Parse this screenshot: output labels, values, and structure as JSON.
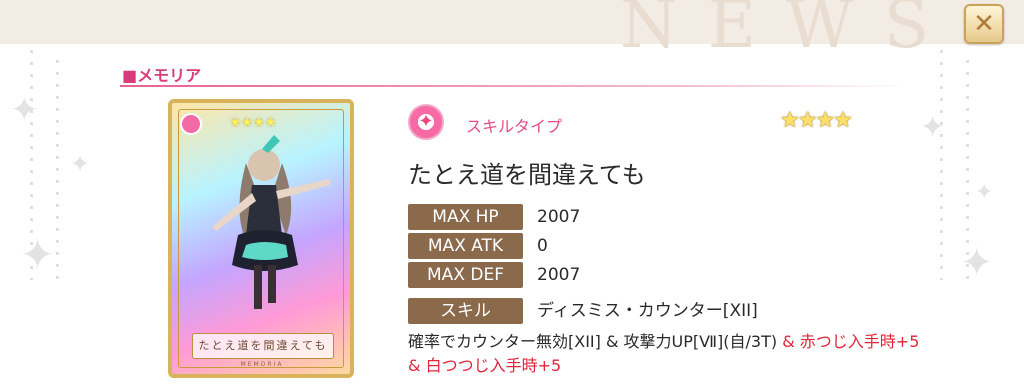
{
  "header": {
    "watermark": "NEWS",
    "close_label": "✕"
  },
  "section": {
    "title": "■メモリア"
  },
  "card": {
    "caption": "たとえ道を間違えても",
    "subcaption": "MEMORIA",
    "stars": "★★★★"
  },
  "memoria": {
    "skill_type_label": "スキルタイプ",
    "rarity": "★★★★",
    "name": "たとえ道を間違えても",
    "stats": [
      {
        "label": "MAX HP",
        "value": "2007"
      },
      {
        "label": "MAX ATK",
        "value": "0"
      },
      {
        "label": "MAX DEF",
        "value": "2007"
      }
    ],
    "skill": {
      "label": "スキル",
      "name": "ディスミス・カウンター[XII]",
      "desc_part1": "確率でカウンター無効[XII] & 攻撃力UP[Ⅶ](自/3T) ",
      "desc_part2": "& 赤つじ入手時+5 & 白つつじ入手時+5"
    }
  },
  "colors": {
    "accent": "#e24e88",
    "stat_bg": "#8b6a4c",
    "highlight": "#e0263b"
  }
}
